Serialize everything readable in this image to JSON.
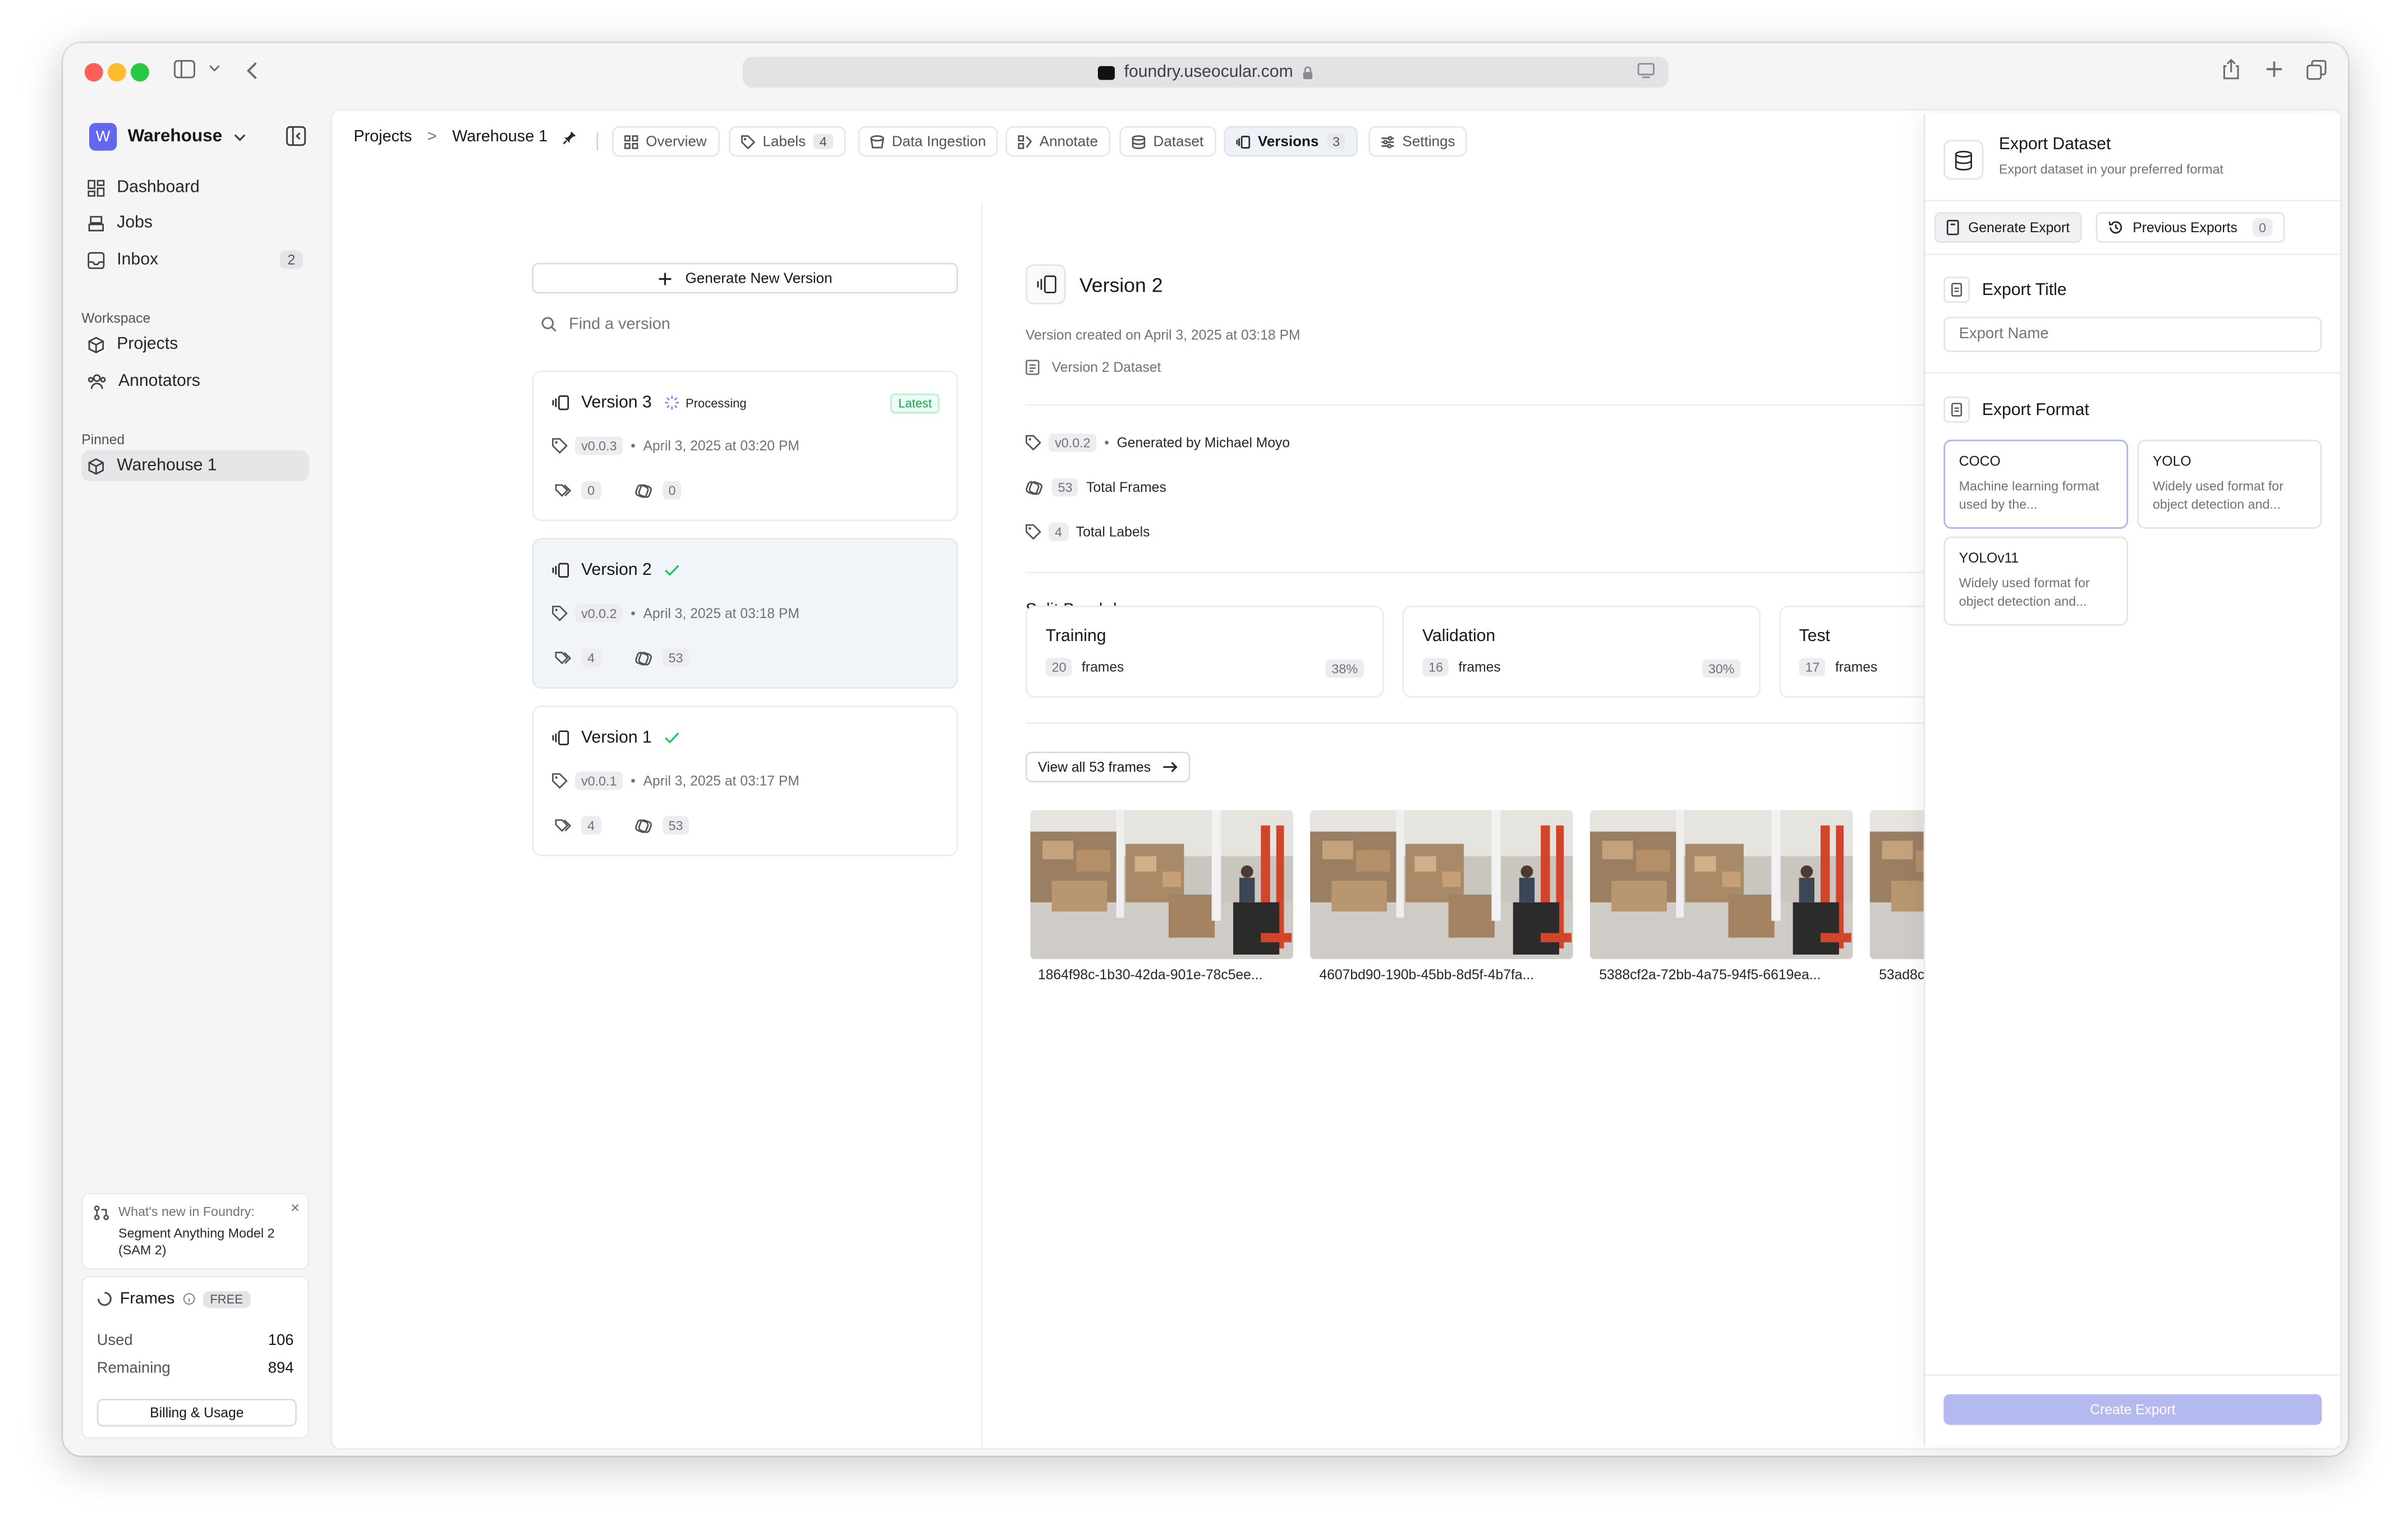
{
  "browser": {
    "url": "foundry.useocular.com"
  },
  "sidebar": {
    "workspace_letter": "W",
    "workspace_name": "Warehouse",
    "nav": [
      {
        "label": "Dashboard",
        "icon": "dashboard-icon"
      },
      {
        "label": "Jobs",
        "icon": "jobs-icon"
      },
      {
        "label": "Inbox",
        "icon": "inbox-icon",
        "count": "2"
      }
    ],
    "workspace_section": "Workspace",
    "workspace_items": [
      {
        "label": "Projects",
        "icon": "cube-icon"
      },
      {
        "label": "Annotators",
        "icon": "users-icon"
      }
    ],
    "pinned_section": "Pinned",
    "pinned_items": [
      {
        "label": "Warehouse 1",
        "icon": "cube-icon"
      }
    ],
    "whats_new": {
      "heading": "What's new in Foundry:",
      "text": "Segment Anything Model 2 (SAM 2)"
    },
    "usage": {
      "title": "Frames",
      "plan": "FREE",
      "used_label": "Used",
      "used_value": "106",
      "remaining_label": "Remaining",
      "remaining_value": "894",
      "button": "Billing & Usage"
    }
  },
  "breadcrumb": {
    "root": "Projects",
    "separator": ">",
    "current": "Warehouse 1"
  },
  "tabs": [
    {
      "label": "Overview",
      "icon": "overview-icon"
    },
    {
      "label": "Labels",
      "icon": "tag-icon",
      "count": "4"
    },
    {
      "label": "Data Ingestion",
      "icon": "bucket-icon"
    },
    {
      "label": "Annotate",
      "icon": "annotate-icon"
    },
    {
      "label": "Dataset",
      "icon": "database-icon"
    },
    {
      "label": "Versions",
      "icon": "versions-icon",
      "count": "3",
      "active": true
    },
    {
      "label": "Settings",
      "icon": "settings-icon"
    }
  ],
  "versions_list": {
    "generate_button": "Generate New Version",
    "search_placeholder": "Find a version",
    "items": [
      {
        "name": "Version 3",
        "status": "Processing",
        "badge": "Latest",
        "tag": "v0.0.3",
        "date": "April 3, 2025 at 03:20 PM",
        "labels": "0",
        "frames": "0"
      },
      {
        "name": "Version 2",
        "status": "done",
        "tag": "v0.0.2",
        "date": "April 3, 2025 at 03:18 PM",
        "labels": "4",
        "frames": "53"
      },
      {
        "name": "Version 1",
        "status": "done",
        "tag": "v0.0.1",
        "date": "April 3, 2025 at 03:17 PM",
        "labels": "4",
        "frames": "53"
      }
    ]
  },
  "detail": {
    "title": "Version 2",
    "created": "Version created on April 3, 2025 at 03:18 PM",
    "dataset": "Version 2 Dataset",
    "tag": "v0.0.2",
    "generated_by": "Generated by Michael Moyo",
    "total_frames_value": "53",
    "total_frames_label": "Total Frames",
    "total_labels_value": "4",
    "total_labels_label": "Total Labels",
    "split_heading": "Split Breakdown",
    "splits": [
      {
        "name": "Training",
        "frames": "20",
        "unit": "frames",
        "percent": "38%"
      },
      {
        "name": "Validation",
        "frames": "16",
        "unit": "frames",
        "percent": "30%"
      },
      {
        "name": "Test",
        "frames": "17",
        "unit": "frames",
        "percent": ""
      }
    ],
    "view_all": "View all 53 frames",
    "thumbnails": [
      {
        "label": "1864f98c-1b30-42da-901e-78c5ee..."
      },
      {
        "label": "4607bd90-190b-45bb-8d5f-4b7fa..."
      },
      {
        "label": "5388cf2a-72bb-4a75-94f5-6619ea..."
      },
      {
        "label": "53ad8c"
      }
    ]
  },
  "export_panel": {
    "title": "Export Dataset",
    "subtitle": "Export dataset in your preferred format",
    "tab_generate": "Generate Export",
    "tab_previous": "Previous Exports",
    "previous_count": "0",
    "title_section": "Export Title",
    "name_placeholder": "Export Name",
    "format_section": "Export Format",
    "formats": [
      {
        "name": "COCO",
        "desc": "Machine learning format used by the...",
        "selected": true
      },
      {
        "name": "YOLO",
        "desc": "Widely used format for object detection and..."
      },
      {
        "name": "YOLOv11",
        "desc": "Widely used format for object detection and..."
      }
    ],
    "create_button": "Create Export"
  },
  "colors": {
    "accent": "#6366f1",
    "success": "#22c55e",
    "disabled_button": "#b4baf0",
    "selected_card": "#f1f4f9"
  }
}
